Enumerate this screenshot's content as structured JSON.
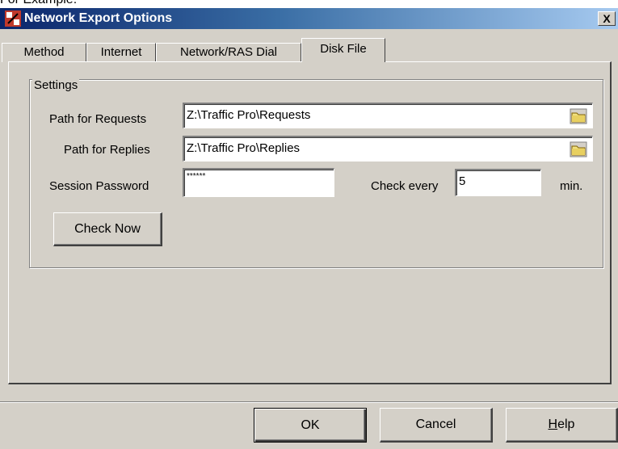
{
  "caption": "For Example:",
  "window": {
    "title": "Network Export Options",
    "close_label": "X"
  },
  "tabs": [
    {
      "label": "Method"
    },
    {
      "label": "Internet"
    },
    {
      "label": "Network/RAS Dial"
    },
    {
      "label": "Disk File"
    }
  ],
  "settings": {
    "group_label": "Settings",
    "requests_label": "Path for Requests",
    "requests_value": "Z:\\Traffic Pro\\Requests",
    "replies_label": "Path for Replies",
    "replies_value": "Z:\\Traffic Pro\\Replies",
    "password_label": "Session Password",
    "password_value": "******",
    "check_every_label": "Check every",
    "check_every_value": "5",
    "min_label": "min.",
    "check_now_label": "Check Now"
  },
  "footer": {
    "ok_label": "OK",
    "cancel_label": "Cancel",
    "help_label_first": "H",
    "help_label_rest": "elp"
  },
  "icons": {
    "app": "network-export-icon",
    "folder": "folder-icon"
  }
}
